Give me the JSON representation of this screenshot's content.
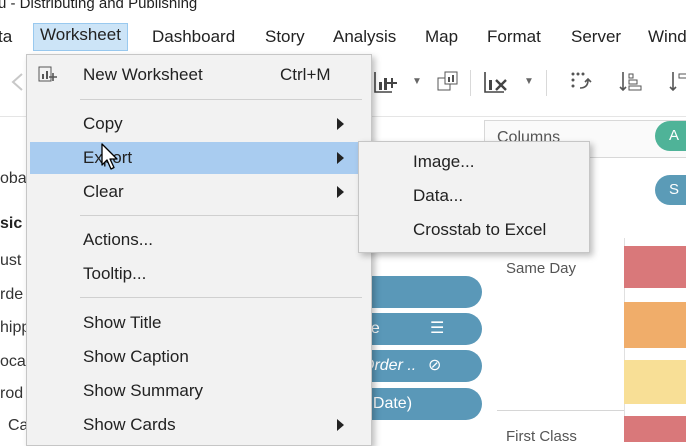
{
  "window": {
    "title": "u - Distributing and Publishing"
  },
  "menubar": {
    "items": [
      {
        "label": "ta"
      },
      {
        "label": "Worksheet"
      },
      {
        "label": "Dashboard"
      },
      {
        "label": "Story"
      },
      {
        "label": "Analysis"
      },
      {
        "label": "Map"
      },
      {
        "label": "Format"
      },
      {
        "label": "Server"
      },
      {
        "label": "Windo"
      }
    ]
  },
  "left_pane": {
    "texts": [
      "oba",
      "sic",
      "ust",
      "rde",
      "hipp",
      "oca",
      "rod",
      "Ca"
    ]
  },
  "shelves": {
    "columns_label": "Columns",
    "columns_pill": "A",
    "rows_pill": "S",
    "marks_pills": [
      "de",
      "Order ..",
      "ip Date)"
    ]
  },
  "viz": {
    "row_headers": [
      "Same Day",
      "First Class"
    ],
    "colors": {
      "bar_red": "#d9787a",
      "bar_orange": "#f0ad6a",
      "bar_yellow": "#f8df96",
      "bar_red2": "#d9787a"
    }
  },
  "worksheet_menu": {
    "items": [
      {
        "label": "New Worksheet",
        "shortcut": "Ctrl+M",
        "icon": "new-worksheet-icon"
      },
      {
        "label": "Copy",
        "submenu": true
      },
      {
        "label": "Export",
        "submenu": true,
        "highlighted": true
      },
      {
        "label": "Clear",
        "submenu": true
      },
      {
        "label": "Actions..."
      },
      {
        "label": "Tooltip..."
      },
      {
        "label": "Show Title"
      },
      {
        "label": "Show Caption"
      },
      {
        "label": "Show Summary"
      },
      {
        "label": "Show Cards",
        "submenu": true
      }
    ]
  },
  "export_submenu": {
    "items": [
      {
        "label": "Image..."
      },
      {
        "label": "Data..."
      },
      {
        "label": "Crosstab to Excel"
      }
    ]
  }
}
